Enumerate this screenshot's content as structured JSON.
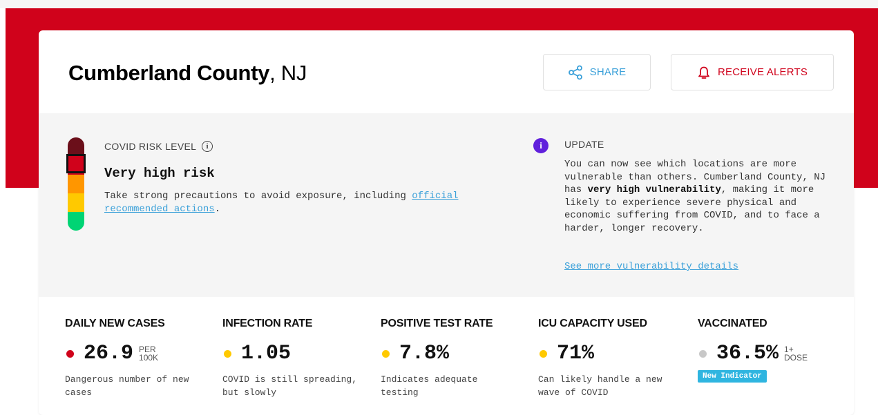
{
  "header": {
    "county": "Cumberland County",
    "state": ", NJ",
    "share_label": "SHARE",
    "alerts_label": "RECEIVE ALERTS"
  },
  "risk": {
    "label": "COVID RISK LEVEL",
    "level": "Very high risk",
    "description": "Take strong precautions to avoid exposure, including ",
    "link": "official recommended actions",
    "description_end": ".",
    "meter_colors": [
      "#6b0f1a",
      "#d0021b",
      "#ff9600",
      "#ffc900",
      "#00d474"
    ]
  },
  "update": {
    "title": "UPDATE",
    "body_before": "You can now see which locations are more vulnerable than others. Cumberland County, NJ has ",
    "body_bold": "very high vulnerability",
    "body_after": ", making it more likely to experience severe physical and economic suffering from COVID, and to face a harder, longer recovery.",
    "link": "See more vulnerability details"
  },
  "metrics": [
    {
      "label": "DAILY NEW CASES",
      "value": "26.9",
      "unit_line1": "PER",
      "unit_line2": "100K",
      "desc": "Dangerous number of new cases",
      "dot": "#d0021b"
    },
    {
      "label": "INFECTION RATE",
      "value": "1.05",
      "desc": "COVID is still spreading, but slowly",
      "dot": "#ffc900"
    },
    {
      "label": "POSITIVE TEST RATE",
      "value": "7.8%",
      "desc": "Indicates adequate testing",
      "dot": "#ffc900"
    },
    {
      "label": "ICU CAPACITY USED",
      "value": "71%",
      "desc": "Can likely handle a new wave of COVID",
      "dot": "#ffc900"
    },
    {
      "label": "VACCINATED",
      "value": "36.5%",
      "unit_line1": "1+",
      "unit_line2": "DOSE",
      "badge": "New Indicator",
      "dot": "#c8c8c8"
    }
  ],
  "colors": {
    "accent_red": "#d0021b",
    "link_blue": "#3aa0d9",
    "update_purple": "#6020dc"
  }
}
